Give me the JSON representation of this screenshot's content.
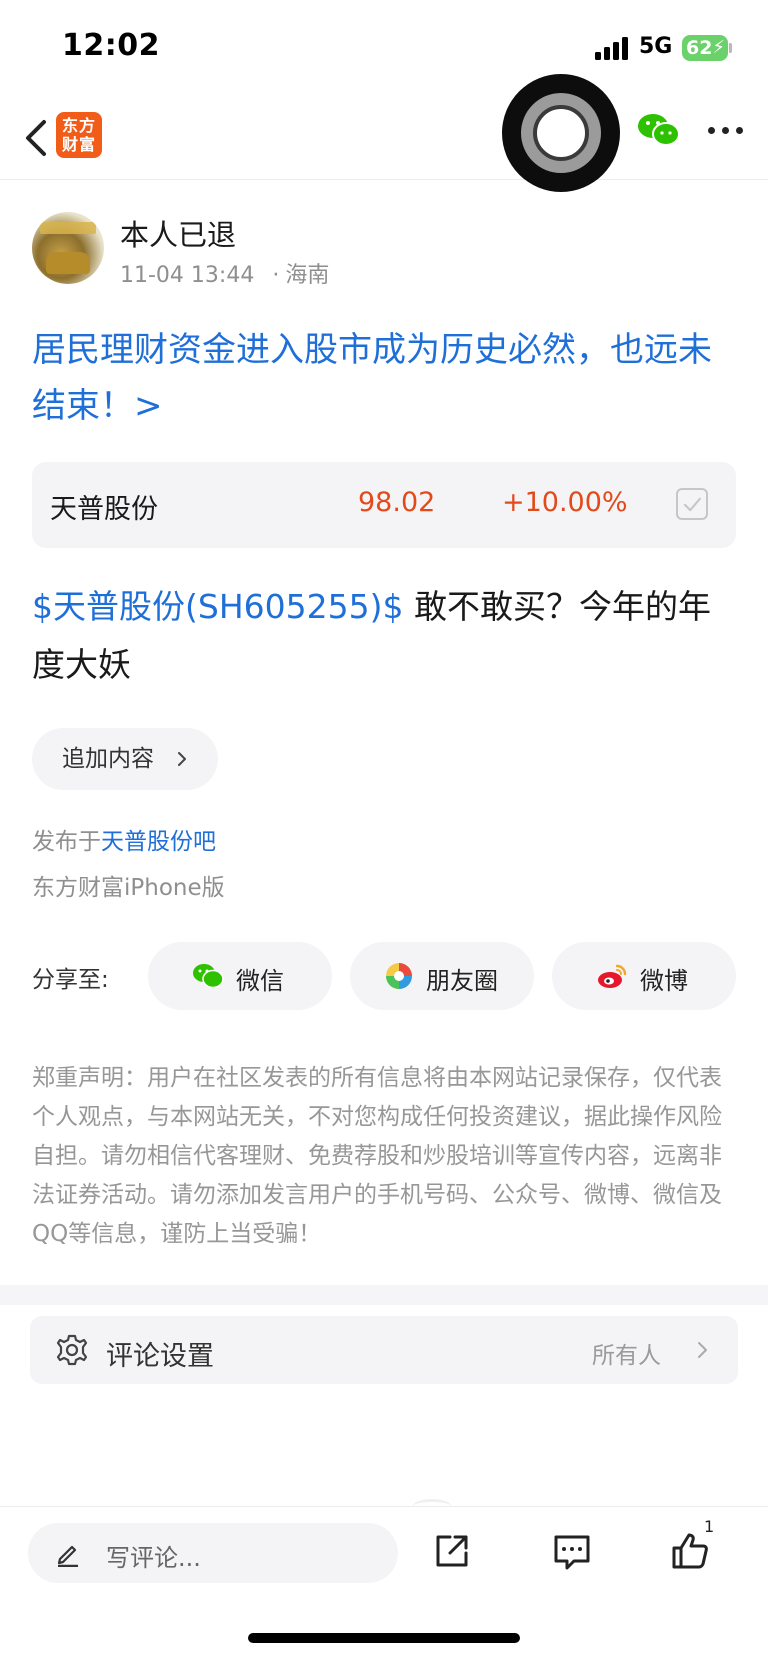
{
  "status_bar": {
    "time": "12:02",
    "network": "5G",
    "battery": "62"
  },
  "nav": {
    "logo_line1": "东方",
    "logo_line2": "财富"
  },
  "post": {
    "author": "本人已退",
    "time": "11-04 13:44",
    "separator": "·",
    "location": "海南",
    "headline": "居民理财资金进入股市成为历史必然，也远未结束！>",
    "stock": {
      "name": "天普股份",
      "price": "98.02",
      "change": "+10.00%"
    },
    "body_tag": "$天普股份(SH605255)$",
    "body_text": " 敢不敢买？今年的年度大妖",
    "append_label": "追加内容",
    "publish_prefix": "发布于",
    "publish_bar": "天普股份吧",
    "client": "东方财富iPhone版"
  },
  "share": {
    "label": "分享至:",
    "wechat": "微信",
    "moments": "朋友圈",
    "weibo": "微博"
  },
  "disclaimer": "郑重声明：用户在社区发表的所有信息将由本网站记录保存，仅代表个人观点，与本网站无关，不对您构成任何投资建议，据此操作风险自担。请勿相信代客理财、免费荐股和炒股培训等宣传内容，远离非法证券活动。请勿添加发言用户的手机号码、公众号、微博、微信及QQ等信息，谨防上当受骗！",
  "comment_settings": {
    "label": "评论设置",
    "value": "所有人"
  },
  "toolbar": {
    "comment_placeholder": "写评论...",
    "like_count": "1"
  },
  "colors": {
    "link": "#1f6fd8",
    "up": "#e24a1a",
    "brand": "#f25c19",
    "wechat": "#2dc100"
  }
}
